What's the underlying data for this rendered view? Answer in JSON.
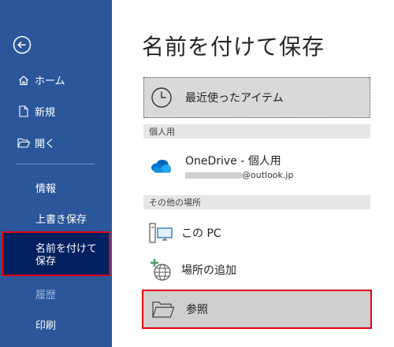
{
  "sidebar": {
    "home": "ホーム",
    "new": "新規",
    "open": "開く",
    "info": "情報",
    "overwrite_save": "上書き保存",
    "save_as": "名前を付けて保存",
    "history": "履歴",
    "print": "印刷"
  },
  "main": {
    "title": "名前を付けて保存",
    "recent": "最近使ったアイテム",
    "personal_header": "個人用",
    "onedrive_title": "OneDrive - 個人用",
    "onedrive_email": "@outlook.jp",
    "other_header": "その他の場所",
    "this_pc": "この PC",
    "add_place": "場所の追加",
    "browse": "参照"
  },
  "colors": {
    "sidebar_bg": "#2b579a",
    "active_bg": "#002060",
    "highlight_border": "#e3000f"
  }
}
